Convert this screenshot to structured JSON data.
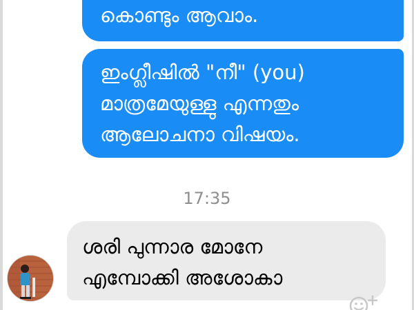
{
  "thread": {
    "messages": [
      {
        "direction": "outgoing",
        "lines": [
          "കൊണ്ടും ആവാം."
        ]
      },
      {
        "direction": "outgoing",
        "lines": [
          "ഇംഗ്ലീഷിൽ \"നീ\" (you)",
          "മാത്രമേയുള്ളു എന്നതും",
          "ആലോചനാ വിഷയം."
        ]
      },
      {
        "direction": "incoming",
        "lines": [
          "ശരി പുന്നാര മോനേ",
          "എമ്പോക്കി അശോകാ"
        ]
      }
    ],
    "timestamp": "17:35"
  },
  "icons": {
    "avatar": "contact-avatar",
    "emoji": "add-reaction-icon"
  },
  "colors": {
    "outgoing_bubble": "#1a8cf5",
    "incoming_bubble": "#ebebeb",
    "timestamp_text": "#8e8e8e"
  }
}
